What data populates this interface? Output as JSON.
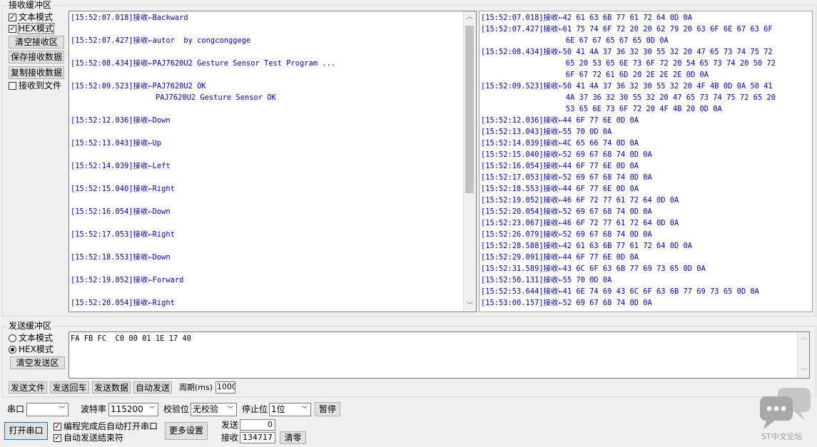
{
  "receive": {
    "title": "接收缓冲区",
    "options": {
      "text_mode": "文本模式",
      "hex_mode": "HEX模式",
      "clear_btn": "清空接收区",
      "save_btn": "保存接收数据",
      "copy_btn": "复制接收数据",
      "to_file": "接收到文件"
    },
    "text_lines": [
      "[15:52:07.018]接收←Backward",
      "",
      "[15:52:07.427]接收←autor  by congconggege",
      "",
      "[15:52:08.434]接收←PAJ7620U2 Gesture Sensor Test Program ...",
      "",
      "[15:52:09.523]接收←PAJ7620U2 OK",
      "                   PAJ7620U2 Gesture Sensor OK",
      "",
      "[15:52:12.036]接收←Down",
      "",
      "[15:52:13.043]接收←Up",
      "",
      "[15:52:14.039]接收←Left",
      "",
      "[15:52:15.040]接收←Right",
      "",
      "[15:52:16.054]接收←Down",
      "",
      "[15:52:17.053]接收←Right",
      "",
      "[15:52:18.553]接收←Down",
      "",
      "[15:52:19.052]接收←Forward",
      "",
      "[15:52:20.054]接收←Right"
    ],
    "hex_lines": [
      "[15:52:07.018]接收←42 61 63 6B 77 61 72 64 0D 0A",
      "[15:52:07.427]接收←61 75 74 6F 72 20 20 62 79 20 63 6F 6E 67 63 6F",
      "                   6E 67 67 65 67 65 0D 0A",
      "[15:52:08.434]接收←50 41 4A 37 36 32 30 55 32 20 47 65 73 74 75 72",
      "                   65 20 53 65 6E 73 6F 72 20 54 65 73 74 20 50 72",
      "                   6F 67 72 61 6D 20 2E 2E 2E 0D 0A",
      "[15:52:09.523]接收←50 41 4A 37 36 32 30 55 32 20 4F 4B 0D 0A 50 41",
      "                   4A 37 36 32 30 55 32 20 47 65 73 74 75 72 65 20",
      "                   53 65 6E 73 6F 72 20 4F 4B 20 0D 0A",
      "[15:52:12.036]接收←44 6F 77 6E 0D 0A",
      "[15:52:13.043]接收←55 70 0D 0A",
      "[15:52:14.039]接收←4C 65 66 74 0D 0A",
      "[15:52:15.040]接收←52 69 67 68 74 0D 0A",
      "[15:52:16.054]接收←44 6F 77 6E 0D 0A",
      "[15:52:17.053]接收←52 69 67 68 74 0D 0A",
      "[15:52:18.553]接收←44 6F 77 6E 0D 0A",
      "[15:52:19.052]接收←46 6F 72 77 61 72 64 0D 0A",
      "[15:52:20.054]接收←52 69 67 68 74 0D 0A",
      "[15:52:23.067]接收←46 6F 72 77 61 72 64 0D 0A",
      "[15:52:26.079]接收←52 69 67 68 74 0D 0A",
      "[15:52:28.588]接收←42 61 63 6B 77 61 72 64 0D 0A",
      "[15:52:29.091]接收←44 6F 77 6E 0D 0A",
      "[15:52:31.589]接收←43 6C 6F 63 6B 77 69 73 65 0D 0A",
      "[15:52:50.131]接收←55 70 0D 0A",
      "[15:52:53.644]接收←41 6E 74 69 43 6C 6F 63 6B 77 69 73 65 0D 0A",
      "[15:53:00.157]接收←52 69 67 68 74 0D 0A"
    ]
  },
  "send": {
    "title": "发送缓冲区",
    "text_mode": "文本模式",
    "hex_mode": "HEX模式",
    "clear_btn": "清空发送区",
    "content": "FA FB FC  C0 00 01 1E 17 40",
    "send_file_btn": "发送文件",
    "send_enter_btn": "发送回车",
    "send_data_btn": "发送数据",
    "auto_send_btn": "自动发送",
    "period_label": "周期(ms)",
    "period_value": "1000"
  },
  "port": {
    "port_label": "串口",
    "port_value": "",
    "baud_label": "波特率",
    "baud_value": "115200",
    "parity_label": "校验位",
    "parity_value": "无校验",
    "stop_label": "停止位",
    "stop_value": "1位",
    "pause_btn": "暂停",
    "open_btn": "打开串口",
    "auto_open": "编程完成后自动打开串口",
    "auto_end": "自动发送结束符",
    "more_btn": "更多设置",
    "tx_label": "发送",
    "tx_value": "0",
    "rx_label": "接收",
    "rx_value": "134717",
    "reset_btn": "清零"
  },
  "watermark": {
    "text": "ST中文论坛"
  }
}
